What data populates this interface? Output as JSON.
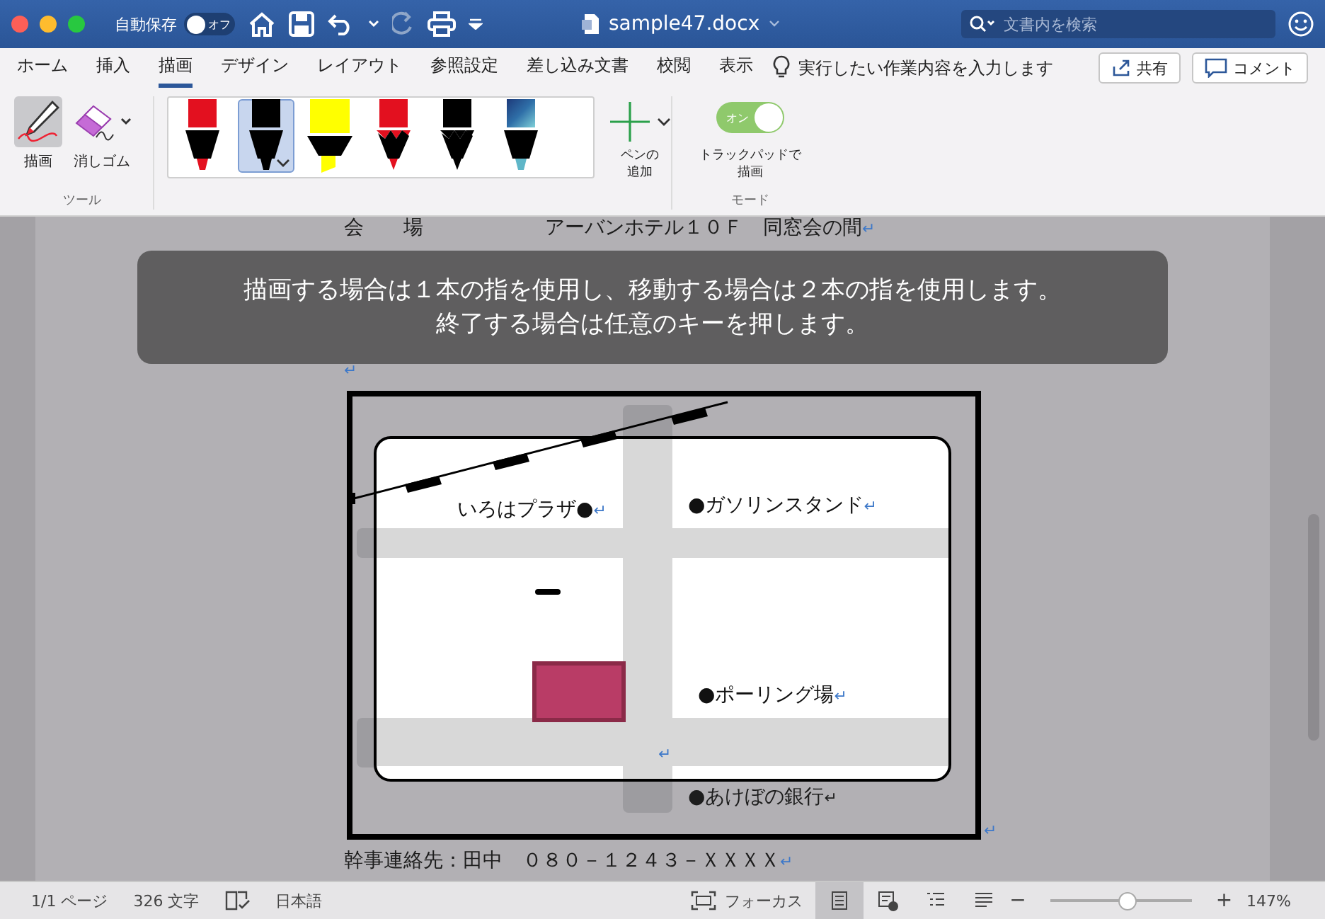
{
  "title_bar": {
    "autosave_label": "自動保存",
    "autosave_toggle": {
      "label": "オフ",
      "on": false
    },
    "document_name": "sample47.docx",
    "search": {
      "placeholder": "文書内を検索"
    }
  },
  "tabs": [
    {
      "label": "ホーム",
      "selected": false
    },
    {
      "label": "挿入",
      "selected": false
    },
    {
      "label": "描画",
      "selected": true
    },
    {
      "label": "デザイン",
      "selected": false
    },
    {
      "label": "レイアウト",
      "selected": false
    },
    {
      "label": "参照設定",
      "selected": false
    },
    {
      "label": "差し込み文書",
      "selected": false
    },
    {
      "label": "校閲",
      "selected": false
    },
    {
      "label": "表示",
      "selected": false
    }
  ],
  "tell_me": "実行したい作業内容を入力します",
  "share_button": "共有",
  "comment_button": "コメント",
  "ribbon": {
    "tools": {
      "buttons": [
        {
          "kind": "draw",
          "label": "描画",
          "selected": true
        },
        {
          "kind": "eraser",
          "label": "消しゴム",
          "selected": false
        }
      ],
      "group_label": "ツール"
    },
    "pens": [
      {
        "kind": "felt",
        "color": "#e3101f",
        "selected": false
      },
      {
        "kind": "felt",
        "color": "#000000",
        "selected": true
      },
      {
        "kind": "highlighter",
        "color": "#ffff00",
        "selected": false
      },
      {
        "kind": "pencil",
        "color": "#e3101f",
        "selected": false
      },
      {
        "kind": "pencil",
        "color": "#000000",
        "selected": false
      },
      {
        "kind": "galaxy",
        "color": "#2f6fa8",
        "selected": false
      }
    ],
    "add_pen": [
      "ペンの",
      "追加"
    ],
    "mode": {
      "toggle": {
        "label": "オン",
        "on": true
      },
      "label": [
        "トラックパッドで",
        "描画"
      ],
      "group_label": "モード"
    }
  },
  "document": {
    "lines": [
      {
        "label": "会　　場",
        "value": "アーバンホテル１０Ｆ　同窓会の間",
        "mark": "↵"
      },
      {
        "kind": "covered"
      },
      {
        "mark": "↵"
      }
    ],
    "map": {
      "labels": [
        {
          "text": "いろはプラザ●",
          "mark": "↵"
        },
        {
          "text": "●ガソリンスタンド",
          "mark": "↵"
        },
        {
          "text": "●ポーリング場",
          "mark": "↵"
        },
        {
          "text": "●あけぼの銀行",
          "mark": "↵"
        }
      ],
      "road_mark": "↵",
      "frame_mark": "↵"
    },
    "last_line": {
      "value": "幹事連絡先：田中　０８０－１２４３－ＸＸＸＸ",
      "mark": "↵"
    }
  },
  "overlay": {
    "lines": [
      "描画する場合は１本の指を使用し、移動する場合は２本の指を使用します。",
      "終了する場合は任意のキーを押します。"
    ]
  },
  "status_bar": {
    "page": "1/1 ページ",
    "words": "326 文字",
    "language": "日本語",
    "focus": "フォーカス",
    "views": [
      {
        "kind": "print",
        "selected": true
      },
      {
        "kind": "web",
        "selected": false
      },
      {
        "kind": "outline",
        "selected": false
      },
      {
        "kind": "draft",
        "selected": false
      }
    ],
    "zoom": {
      "minus": "−",
      "plus": "+",
      "level": 0.55,
      "value": "147%"
    }
  }
}
